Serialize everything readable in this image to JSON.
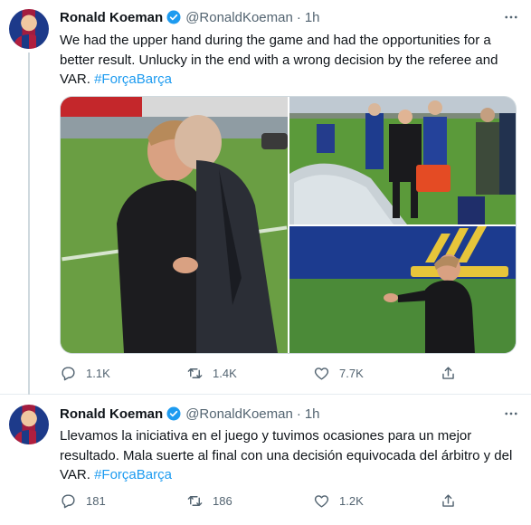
{
  "tweets": [
    {
      "author_name": "Ronald Koeman",
      "handle": "@RonaldKoeman",
      "separator": "·",
      "time": "1h",
      "text_main": "We had the upper hand during the game and had the opportunities for a better result. Unlucky in the end with a wrong decision by the referee and VAR. ",
      "hashtag": "#ForçaBarça",
      "actions": {
        "replies": "1.1K",
        "retweets": "1.4K",
        "likes": "7.7K"
      }
    },
    {
      "author_name": "Ronald Koeman",
      "handle": "@RonaldKoeman",
      "separator": "·",
      "time": "1h",
      "text_main": "Llevamos la iniciativa en el juego y tuvimos ocasiones para un mejor resultado. Mala suerte al final con una decisión equivocada del árbitro y del VAR. ",
      "hashtag": "#ForçaBarça",
      "actions": {
        "replies": "181",
        "retweets": "186",
        "likes": "1.2K"
      }
    }
  ],
  "icons": {
    "verified": "verified-badge-icon",
    "more": "more-options-icon",
    "reply": "reply-icon",
    "retweet": "retweet-icon",
    "like": "like-icon",
    "share": "share-icon"
  },
  "colors": {
    "accent": "#1d9bf0",
    "secondary_text": "#536471",
    "divider": "#e6ecf0"
  }
}
